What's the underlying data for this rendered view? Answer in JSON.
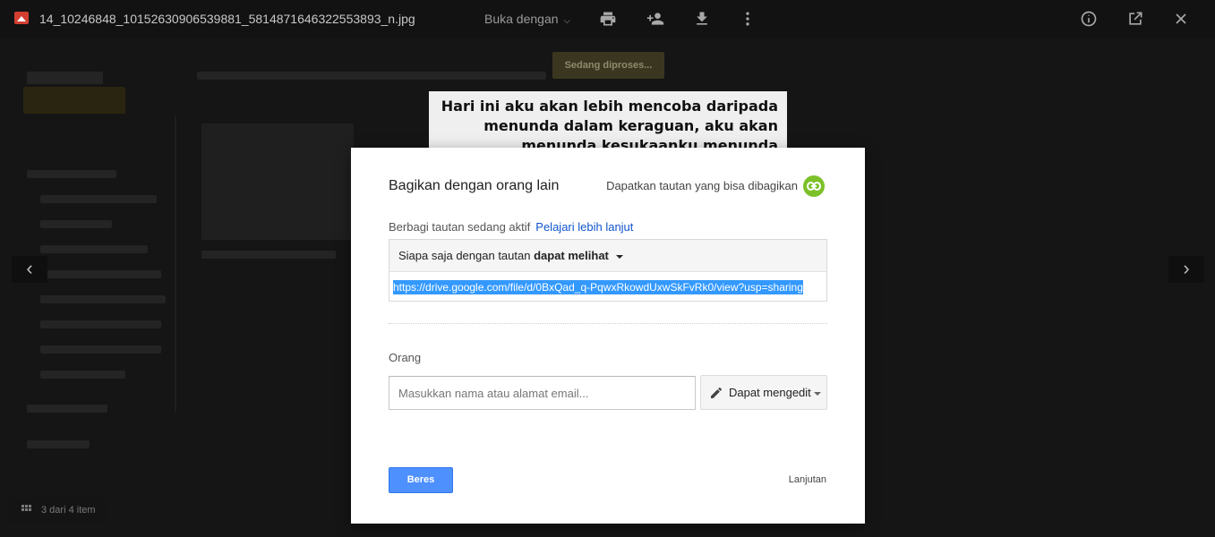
{
  "topbar": {
    "file_name": "14_10246848_10152630906539881_5814871646322553893_n.jpg",
    "open_with": "Buka dengan",
    "icons": [
      "print-icon",
      "add-person-icon",
      "download-icon",
      "more-vert-icon",
      "info-icon",
      "open-external-icon",
      "close-icon"
    ]
  },
  "background": {
    "processing_label": "Sedang diproses...",
    "image_caption": "Hari ini aku akan lebih mencoba daripada menunda dalam keraguan, aku akan menunda kesukaanku menunda",
    "page_count": "3 dari 4 item"
  },
  "dialog": {
    "title": "Bagikan dengan orang lain",
    "get_link_label": "Dapatkan tautan yang bisa dibagikan",
    "link_sharing_status": "Berbagi tautan sedang aktif",
    "learn_more": "Pelajari lebih lanjut",
    "access_prefix": "Siapa saja dengan tautan",
    "access_level": "dapat melihat",
    "share_url": "https://drive.google.com/file/d/0BxQad_q-PqwxRkowdUxwSkFvRk0/view?usp=sharing",
    "people_label": "Orang",
    "people_placeholder": "Masukkan nama atau alamat email...",
    "permission_label": "Dapat mengedit",
    "done_label": "Beres",
    "advanced_label": "Lanjutan"
  },
  "colors": {
    "primary_button": "#4d90fe",
    "link": "#1155cc",
    "link_badge": "#7cc129",
    "selection": "#3399ff"
  }
}
